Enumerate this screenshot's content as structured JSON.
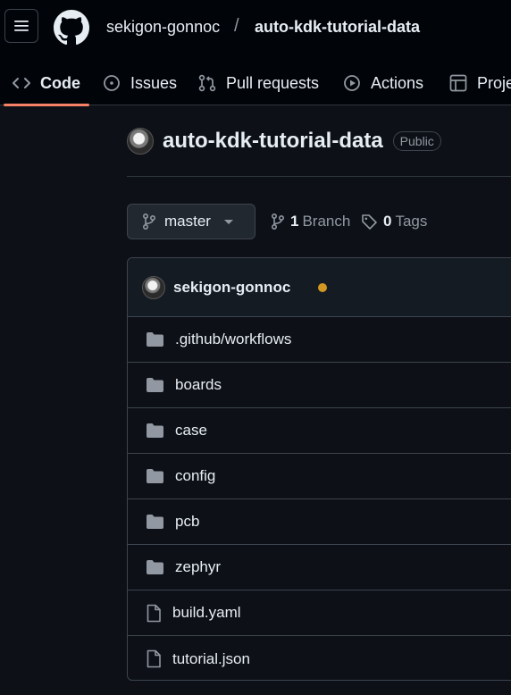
{
  "header": {
    "owner": "sekigon-gonnoc",
    "separator": "/",
    "repo": "auto-kdk-tutorial-data"
  },
  "tabs": [
    {
      "label": "Code",
      "icon": "code-icon"
    },
    {
      "label": "Issues",
      "icon": "issue-opened-icon"
    },
    {
      "label": "Pull requests",
      "icon": "git-pull-request-icon"
    },
    {
      "label": "Actions",
      "icon": "play-icon"
    },
    {
      "label": "Proje",
      "icon": "table-icon"
    }
  ],
  "repo": {
    "name": "auto-kdk-tutorial-data",
    "visibility": "Public"
  },
  "branch": {
    "current": "master",
    "branch_count": "1",
    "branch_label": "Branch",
    "tag_count": "0",
    "tag_label": "Tags"
  },
  "commit": {
    "author": "sekigon-gonnoc",
    "status_color": "#d29922"
  },
  "files": [
    {
      "name": ".github/workflows",
      "type": "folder"
    },
    {
      "name": "boards",
      "type": "folder"
    },
    {
      "name": "case",
      "type": "folder"
    },
    {
      "name": "config",
      "type": "folder"
    },
    {
      "name": "pcb",
      "type": "folder"
    },
    {
      "name": "zephyr",
      "type": "folder"
    },
    {
      "name": "build.yaml",
      "type": "file"
    },
    {
      "name": "tutorial.json",
      "type": "file"
    }
  ],
  "colors": {
    "background": "#0d1117",
    "header": "#010409",
    "accent_underline": "#f78166",
    "border": "#3d444d",
    "folder": "#9198a1"
  }
}
